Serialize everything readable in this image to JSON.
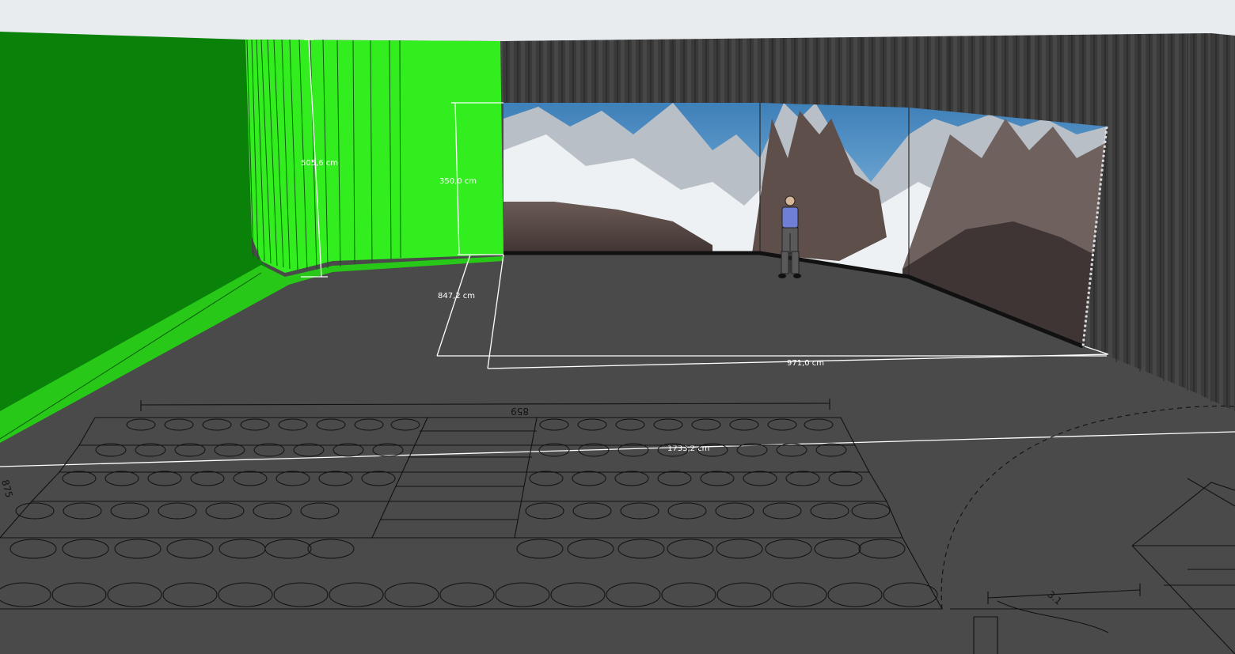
{
  "dimensions": {
    "green_wall_height": "505,6 cm",
    "led_wall_height": "350,0 cm",
    "stage_depth": "847,2 cm",
    "led_wall_width": "971,0 cm",
    "studio_width": "1733,2 cm"
  },
  "floor_plan_marks": {
    "seating_width": "859",
    "left_side": "875",
    "stair_mark": "3.1"
  },
  "colors": {
    "floor": "#4a4a4a",
    "green_screen": "#2ee61a",
    "green_dark": "#0b7f0b",
    "curtain": "#3d3d3d",
    "sky": "#e9ecef",
    "dimension_line": "#ffffff"
  },
  "figure": {
    "shirt_color": "#6f7fd6",
    "pants_color": "#5a5a5a"
  }
}
